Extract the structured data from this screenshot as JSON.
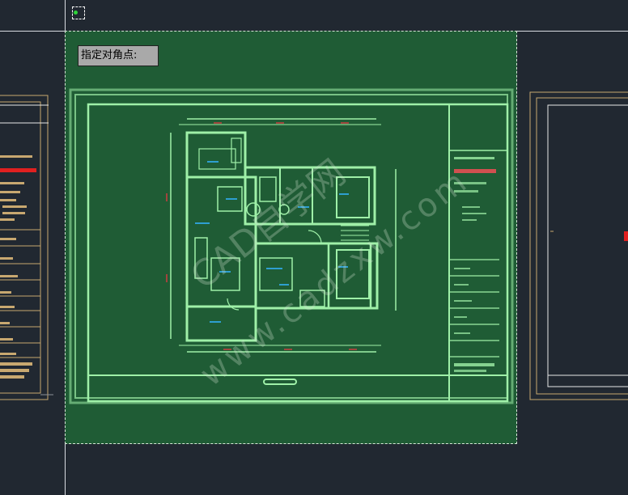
{
  "prompt": {
    "text": "指定对角点:"
  },
  "watermark": {
    "text": "www.cadzxw.com",
    "brand": "CAD自学网"
  },
  "colors": {
    "model_background": "#212831",
    "selection_fill": "#1f5c35",
    "drawing_lines": "#9ff0a8",
    "frame_lines": "#c8a870",
    "highlight": "#e02020"
  },
  "icons": {
    "ucs": "ucs-origin-icon"
  }
}
